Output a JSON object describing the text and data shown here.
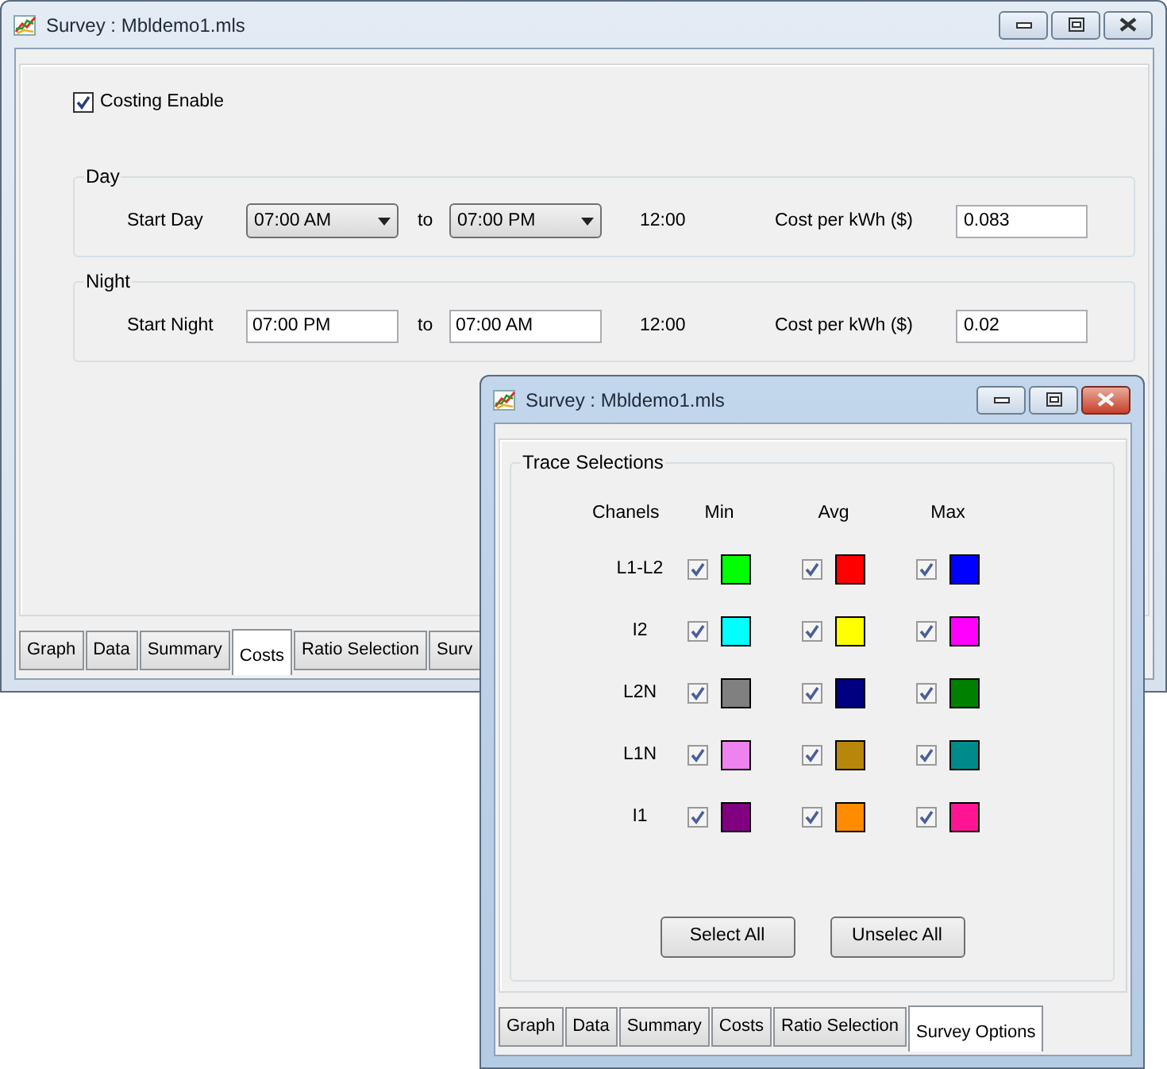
{
  "costs_window": {
    "title": "Survey : Mbldemo1.mls",
    "active": false,
    "costing_enable": {
      "label": "Costing Enable",
      "checked": true
    },
    "periods": [
      {
        "legend": "Day",
        "kind": "dropdown",
        "start_label": "Start Day",
        "start": "07:00 AM",
        "to_label": "to",
        "end": "07:00 PM",
        "duration": "12:00",
        "cost_label": "Cost per kWh ($)",
        "cost": "0.083"
      },
      {
        "legend": "Night",
        "kind": "textbox",
        "start_label": "Start Night",
        "start": "07:00 PM",
        "to_label": "to",
        "end": "07:00 AM",
        "duration": "12:00",
        "cost_label": "Cost per kWh ($)",
        "cost": "0.02"
      }
    ],
    "tabs": [
      {
        "label": "Graph",
        "selected": false
      },
      {
        "label": "Data",
        "selected": false
      },
      {
        "label": "Summary",
        "selected": false
      },
      {
        "label": "Costs",
        "selected": true
      },
      {
        "label": "Ratio Selection",
        "selected": false
      },
      {
        "label": "Surv",
        "selected": false
      }
    ]
  },
  "options_window": {
    "title": "Survey : Mbldemo1.mls",
    "active": true,
    "group": "Trace Selections",
    "headers": [
      "Chanels",
      "Min",
      "Avg",
      "Max"
    ],
    "channels": [
      {
        "name": "L1-L2",
        "traces": [
          {
            "checked": true,
            "color": "#00ff00"
          },
          {
            "checked": true,
            "color": "#ff0000"
          },
          {
            "checked": true,
            "color": "#0000ff"
          }
        ]
      },
      {
        "name": "I2",
        "traces": [
          {
            "checked": true,
            "color": "#00ffff"
          },
          {
            "checked": true,
            "color": "#ffff00"
          },
          {
            "checked": true,
            "color": "#ff00ff"
          }
        ]
      },
      {
        "name": "L2N",
        "traces": [
          {
            "checked": true,
            "color": "#808080"
          },
          {
            "checked": true,
            "color": "#000080"
          },
          {
            "checked": true,
            "color": "#008000"
          }
        ]
      },
      {
        "name": "L1N",
        "traces": [
          {
            "checked": true,
            "color": "#ee82ee"
          },
          {
            "checked": true,
            "color": "#b8860b"
          },
          {
            "checked": true,
            "color": "#008b8b"
          }
        ]
      },
      {
        "name": "I1",
        "traces": [
          {
            "checked": true,
            "color": "#800080"
          },
          {
            "checked": true,
            "color": "#ff8c00"
          },
          {
            "checked": true,
            "color": "#ff1493"
          }
        ]
      }
    ],
    "buttons": [
      "Select All",
      "Unselec All"
    ],
    "tabs": [
      {
        "label": "Graph",
        "selected": false
      },
      {
        "label": "Data",
        "selected": false
      },
      {
        "label": "Summary",
        "selected": false
      },
      {
        "label": "Costs",
        "selected": false
      },
      {
        "label": "Ratio Selection",
        "selected": false
      },
      {
        "label": "Survey Options",
        "selected": true
      }
    ]
  }
}
